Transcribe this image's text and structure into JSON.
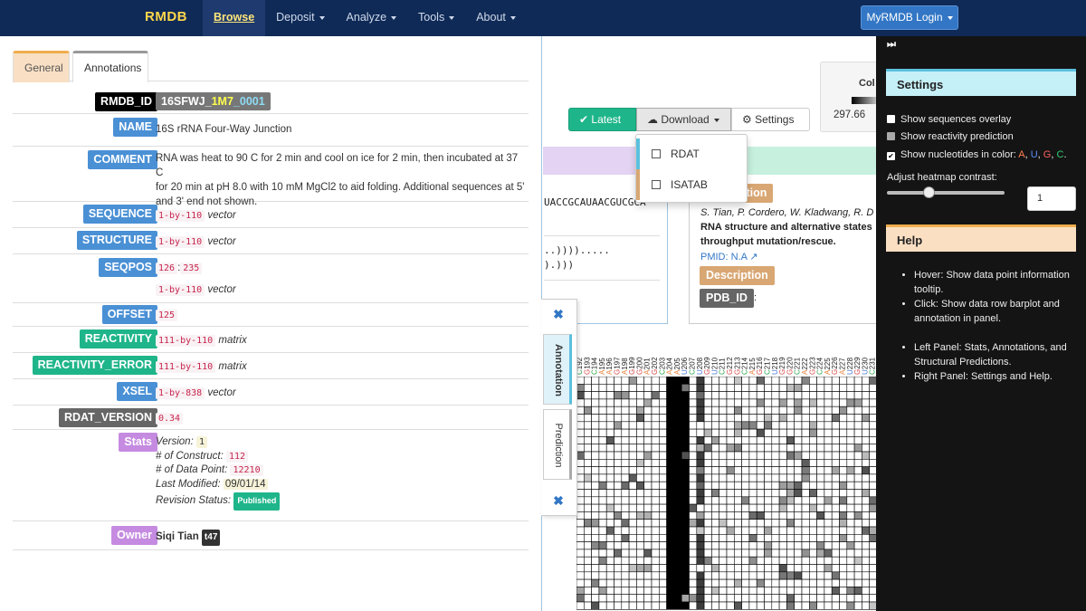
{
  "navbar": {
    "brand": "RMDB",
    "items": [
      {
        "label": "Browse",
        "active": true,
        "caret": false
      },
      {
        "label": "Deposit",
        "caret": true
      },
      {
        "label": "Analyze",
        "caret": true
      },
      {
        "label": "Tools",
        "caret": true
      },
      {
        "label": "About",
        "caret": true
      }
    ],
    "login_label": "MyRMDB Login"
  },
  "left_panel": {
    "tabs": {
      "general": "General",
      "annotations": "Annotations"
    },
    "rmdb_id": {
      "label": "RMDB_ID",
      "value_part1": "16SFWJ_",
      "value_part2": "1M7",
      "value_part3": "_0001"
    },
    "name": {
      "label": "NAME",
      "value": "16S rRNA Four-Way Junction"
    },
    "comment": {
      "label": "COMMENT",
      "line1": "RNA was heat to 90 C for 2 min and cool on ice for 2 min, then incubated at 37 C",
      "line2": "for 20 min at pH 8.0 with 10 mM MgCl2 to aid folding. Additional sequences at 5'",
      "line3": "and 3' end not shown."
    },
    "sequence": {
      "label": "SEQUENCE",
      "dims": "1-by-110",
      "kind": "vector"
    },
    "structure": {
      "label": "STRUCTURE",
      "dims": "1-by-110",
      "kind": "vector"
    },
    "seqpos": {
      "label": "SEQPOS",
      "range_start": "126",
      "range_sep": ":",
      "range_end": "235",
      "dims": "1-by-110",
      "kind": "vector"
    },
    "offset": {
      "label": "OFFSET",
      "value": "125"
    },
    "reactivity": {
      "label": "REACTIVITY",
      "dims": "111-by-110",
      "kind": "matrix"
    },
    "reactivity_error": {
      "label": "REACTIVITY_ERROR",
      "dims": "111-by-110",
      "kind": "matrix"
    },
    "xsel": {
      "label": "XSEL",
      "dims": "1-by-838",
      "kind": "vector"
    },
    "rdat_version": {
      "label": "RDAT_VERSION",
      "value": "0.34"
    },
    "stats": {
      "label": "Stats",
      "version_label": "Version:",
      "version": "1",
      "constructs_label": "# of Construct:",
      "constructs": "112",
      "datapoints_label": "# of Data Point:",
      "datapoints": "12210",
      "modified_label": "Last Modified:",
      "modified": "09/01/14",
      "revision_label": "Revision Status:",
      "revision": "Published"
    },
    "owner": {
      "label": "Owner",
      "name": "Siqi Tian",
      "tag": "t47"
    }
  },
  "main": {
    "colorbar": {
      "title": "Col",
      "value": "297.66"
    },
    "toolbar": {
      "latest": "Latest",
      "download": "Download",
      "settings": "Settings"
    },
    "download_menu": [
      "RDAT",
      "ISATAB"
    ],
    "sequence_lines": [
      "UACCGCAUAACGUCGCA",
      "..)))).....",
      ").)))"
    ],
    "reference": {
      "publication_label": "Publication",
      "authors": "S. Tian, P. Cordero, W. Kladwang, R. D",
      "title1": "RNA structure and alternative states",
      "title2": "throughput mutation/rescue.",
      "pmid_label": "PMID:",
      "pmid": "N.A",
      "description_label": "Description",
      "pdb_label": "PDB_ID",
      "pdb_value": ":"
    },
    "side_tabs": {
      "close_top": "✖",
      "annotation": "Annotation",
      "prediction": "Prediction",
      "close_bottom": "✖"
    },
    "heatmap": {
      "columns": [
        {
          "nt": "C",
          "pos": "192"
        },
        {
          "nt": "G",
          "pos": "193"
        },
        {
          "nt": "C",
          "pos": "194"
        },
        {
          "nt": "A",
          "pos": "195"
        },
        {
          "nt": "A",
          "pos": "196"
        },
        {
          "nt": "G",
          "pos": "197"
        },
        {
          "nt": "A",
          "pos": "198"
        },
        {
          "nt": "G",
          "pos": "199"
        },
        {
          "nt": "G",
          "pos": "200"
        },
        {
          "nt": "A",
          "pos": "201"
        },
        {
          "nt": "G",
          "pos": "202"
        },
        {
          "nt": "C",
          "pos": "203"
        },
        {
          "nt": "A",
          "pos": "204"
        },
        {
          "nt": "A",
          "pos": "205"
        },
        {
          "nt": "U",
          "pos": "206"
        },
        {
          "nt": "C",
          "pos": "207"
        },
        {
          "nt": "U",
          "pos": "208"
        },
        {
          "nt": "G",
          "pos": "209"
        },
        {
          "nt": "U",
          "pos": "210"
        },
        {
          "nt": "C",
          "pos": "211"
        },
        {
          "nt": "G",
          "pos": "212"
        },
        {
          "nt": "G",
          "pos": "213"
        },
        {
          "nt": "C",
          "pos": "214"
        },
        {
          "nt": "A",
          "pos": "215"
        },
        {
          "nt": "G",
          "pos": "216"
        },
        {
          "nt": "C",
          "pos": "217"
        },
        {
          "nt": "U",
          "pos": "218"
        },
        {
          "nt": "G",
          "pos": "219"
        },
        {
          "nt": "G",
          "pos": "220"
        },
        {
          "nt": "C",
          "pos": "221"
        },
        {
          "nt": "A",
          "pos": "222"
        },
        {
          "nt": "G",
          "pos": "223"
        },
        {
          "nt": "C",
          "pos": "224"
        },
        {
          "nt": "A",
          "pos": "225"
        },
        {
          "nt": "G",
          "pos": "226"
        },
        {
          "nt": "A",
          "pos": "227"
        },
        {
          "nt": "U",
          "pos": "228"
        },
        {
          "nt": "G",
          "pos": "229"
        },
        {
          "nt": "U",
          "pos": "230"
        },
        {
          "nt": "C",
          "pos": "231"
        }
      ],
      "nt_colors": {
        "A": "#e8843e",
        "U": "#4a78d8",
        "G": "#d84a4a",
        "C": "#2aa84a"
      }
    }
  },
  "right_panel": {
    "toggle": "⏭",
    "settings_title": "Settings",
    "options": [
      {
        "label": "Show sequences overlay",
        "checked": false
      },
      {
        "label": "Show reactivity prediction",
        "checked": false,
        "disabled": true
      },
      {
        "label": "Show nucleotides in color:",
        "checked": true
      }
    ],
    "nucleotide_letters": [
      "A",
      "U",
      "G",
      "C"
    ],
    "contrast_label": "Adjust heatmap contrast:",
    "contrast_value": "1",
    "help_title": "Help",
    "help_items": [
      "Hover: Show data point information tooltip.",
      "Click: Show data row barplot and annotation in panel.",
      "Left Panel: Stats, Annotations, and Structural Predictions.",
      "Right Panel: Settings and Help."
    ]
  }
}
